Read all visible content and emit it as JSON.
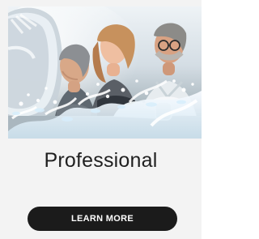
{
  "card": {
    "title": "Professional",
    "button_label": "LEARN MORE",
    "image_icon": "professional-people-water-image"
  },
  "colors": {
    "page_background": "#f3f3f3",
    "button_background": "#1b1b1b",
    "button_text": "#ffffff",
    "title_text": "#1f1f1f"
  }
}
